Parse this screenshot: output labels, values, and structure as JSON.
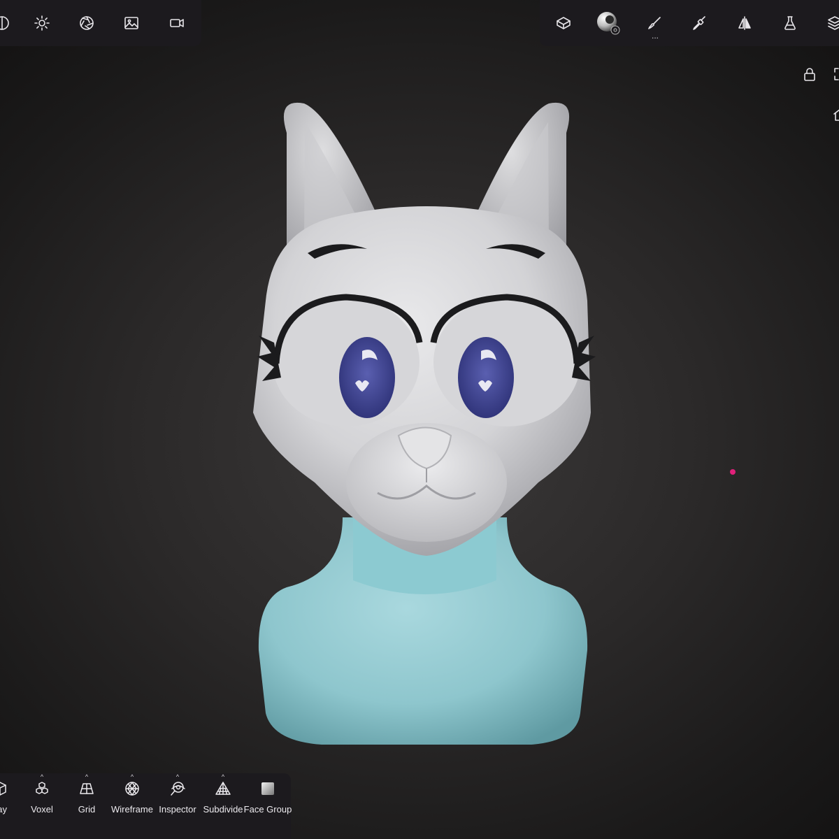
{
  "top_left_toolbar": {
    "items": [
      {
        "name": "partial-icon"
      },
      {
        "name": "sun-icon"
      },
      {
        "name": "aperture-icon"
      },
      {
        "name": "image-icon"
      },
      {
        "name": "video-icon"
      }
    ]
  },
  "top_right_toolbar": {
    "items": [
      {
        "name": "scene-icon"
      },
      {
        "name": "material-sphere-icon"
      },
      {
        "name": "brush-icon",
        "badge": "..."
      },
      {
        "name": "paint-brush-icon"
      },
      {
        "name": "symmetry-icon"
      },
      {
        "name": "flask-icon"
      },
      {
        "name": "layers-icon"
      }
    ]
  },
  "bottom_toolbar": {
    "items": [
      {
        "label": "ay",
        "icon": "cube-icon"
      },
      {
        "label": "Voxel",
        "icon": "voxel-icon"
      },
      {
        "label": "Grid",
        "icon": "grid-icon"
      },
      {
        "label": "Wireframe",
        "icon": "wireframe-icon"
      },
      {
        "label": "Inspector",
        "icon": "inspector-icon"
      },
      {
        "label": "Subdivide",
        "icon": "subdivide-icon"
      },
      {
        "label": "Face Group",
        "icon": "face-group-icon"
      }
    ],
    "caret": "^"
  },
  "colors": {
    "toolbar_bg": "#1c1a1e",
    "head": "#d8d8da",
    "body": "#8ec6cd",
    "iris": "#3a3f8c",
    "pivot": "#e0207a"
  }
}
